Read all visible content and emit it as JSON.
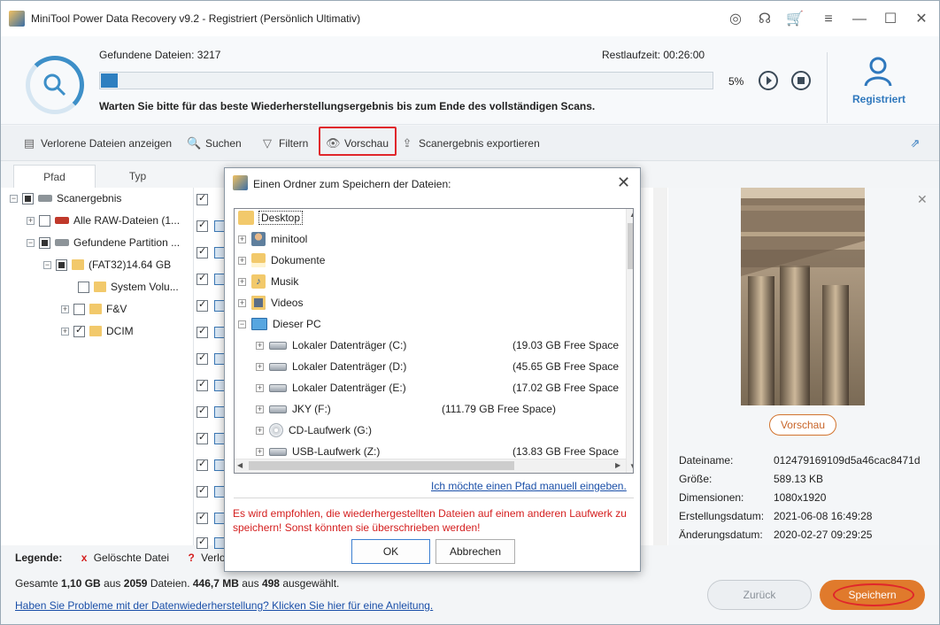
{
  "window": {
    "title": "MiniTool Power Data Recovery v9.2 - Registriert (Persönlich Ultimativ)"
  },
  "scan": {
    "found_label": "Gefundene Dateien:",
    "found_count": "3217",
    "remaining_label": "Restlaufzeit:",
    "remaining_time": "00:26:00",
    "progress_percent": 5,
    "progress_text": "5%",
    "message": "Warten Sie bitte für das beste Wiederherstellungsergebnis bis zum Ende des vollständigen Scans.",
    "user_label": "Registriert"
  },
  "toolbar": {
    "lost_files": "Verlorene Dateien anzeigen",
    "search": "Suchen",
    "filter": "Filtern",
    "preview": "Vorschau",
    "export": "Scanergebnis exportieren"
  },
  "tabs": [
    "Pfad",
    "Typ"
  ],
  "tree": {
    "root": "Scanergebnis",
    "raw": "Alle RAW-Dateien (1...",
    "found_partition": "Gefundene Partition ...",
    "fat32": "(FAT32)14.64 GB",
    "system_volume": "System Volu...",
    "fv": "F&V",
    "dcim": "DCIM"
  },
  "list": {
    "header_fragment": "tu"
  },
  "preview": {
    "button": "Vorschau",
    "meta": [
      {
        "key": "Dateiname:",
        "value": "012479169109d5a46cac8471d"
      },
      {
        "key": "Größe:",
        "value": "589.13 KB"
      },
      {
        "key": "Dimensionen:",
        "value": "1080x1920"
      },
      {
        "key": "Erstellungsdatum:",
        "value": "2021-06-08 16:49:28"
      },
      {
        "key": "Änderungsdatum:",
        "value": "2020-02-27 09:29:25"
      }
    ]
  },
  "legend": {
    "label": "Legende:",
    "deleted_mark": "x",
    "deleted": "Gelöschte Datei",
    "lost_mark": "?",
    "lost_fragment": "Verlo"
  },
  "summary": {
    "total_label": "Gesamte",
    "total_size": "1,10 GB",
    "in_label": "aus",
    "total_files": "2059",
    "files_label": "Dateien.",
    "selected_size": "446,7 MB",
    "of_label": "aus",
    "selected_count": "498",
    "selected_label": "ausgewählt."
  },
  "help_link": "Haben Sie Probleme mit der Datenwiederherstellung? Klicken Sie hier für eine Anleitung.",
  "buttons": {
    "back": "Zurück",
    "save": "Speichern"
  },
  "dialog": {
    "title": "Einen Ordner zum Speichern der Dateien:",
    "items": [
      {
        "label": "Desktop",
        "size": ""
      },
      {
        "label": "minitool",
        "size": ""
      },
      {
        "label": "Dokumente",
        "size": ""
      },
      {
        "label": "Musik",
        "size": ""
      },
      {
        "label": "Videos",
        "size": ""
      },
      {
        "label": "Dieser PC",
        "size": ""
      },
      {
        "label": "Lokaler Datenträger (C:)",
        "size": "(19.03 GB Free Space"
      },
      {
        "label": "Lokaler Datenträger (D:)",
        "size": "(45.65 GB Free Space"
      },
      {
        "label": "Lokaler Datenträger (E:)",
        "size": "(17.02 GB Free Space"
      },
      {
        "label": "JKY (F:)",
        "size": "(111.79 GB Free Space)"
      },
      {
        "label": "CD-Laufwerk (G:)",
        "size": ""
      },
      {
        "label": "USB-Laufwerk (Z:)",
        "size": "(13.83 GB Free Space"
      }
    ],
    "manual_link": "Ich möchte einen Pfad manuell eingeben.",
    "warning": "Es wird empfohlen, die wiederhergestellten Dateien auf einem anderen Laufwerk zu speichern! Sonst könnten sie überschrieben werden!",
    "ok": "OK",
    "cancel": "Abbrechen"
  },
  "colors": {
    "accent": "#2e7fc0",
    "save": "#e07a2c",
    "highlight": "#e0262b",
    "warning": "#d41e1e",
    "link": "#1a4fa8"
  }
}
